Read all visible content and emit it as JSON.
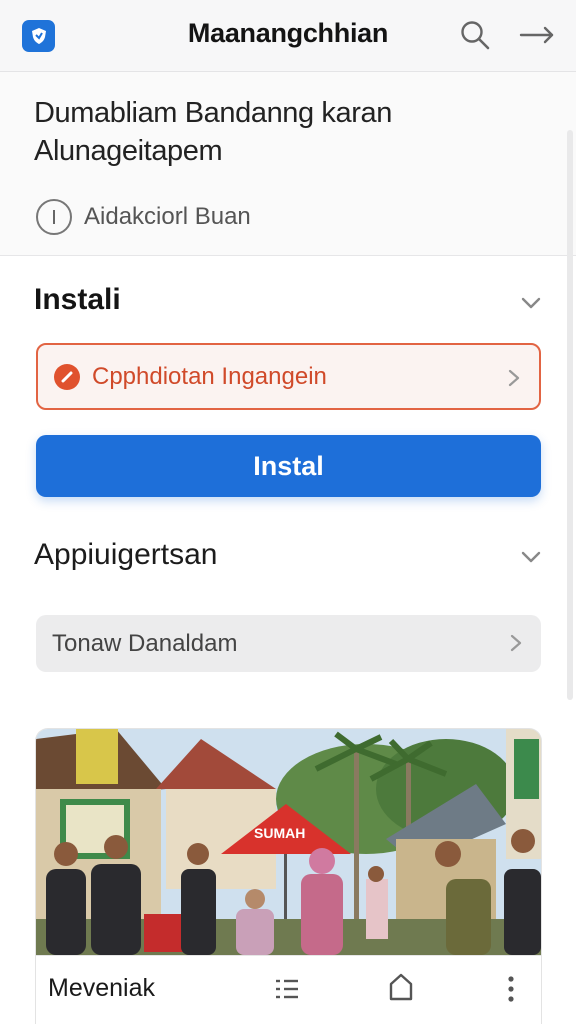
{
  "topbar": {
    "title": "Maanangchhian",
    "app_icon": "shield-icon",
    "search_icon": "search-icon",
    "forward_icon": "arrow-right-icon"
  },
  "header": {
    "headline_line1": "Dumabliam Bandanng karan",
    "headline_line2": "Alunageitapem",
    "meta_text": "Aidakciorl Buan",
    "meta_icon": "info-icon"
  },
  "install_section": {
    "title": "Instali",
    "alert_text": "Cpphdiotan Ingangein",
    "alert_color": "#e26443",
    "button_label": "Instal",
    "button_color": "#1e6fd9"
  },
  "app_section": {
    "title": "Appiuigertsan",
    "select_value": "Tonaw Danaldam"
  },
  "photo_card": {
    "banner_text": "SUMAH",
    "label": "Meveniak",
    "icons": [
      "list-icon",
      "home-icon",
      "more-vertical-icon"
    ]
  }
}
